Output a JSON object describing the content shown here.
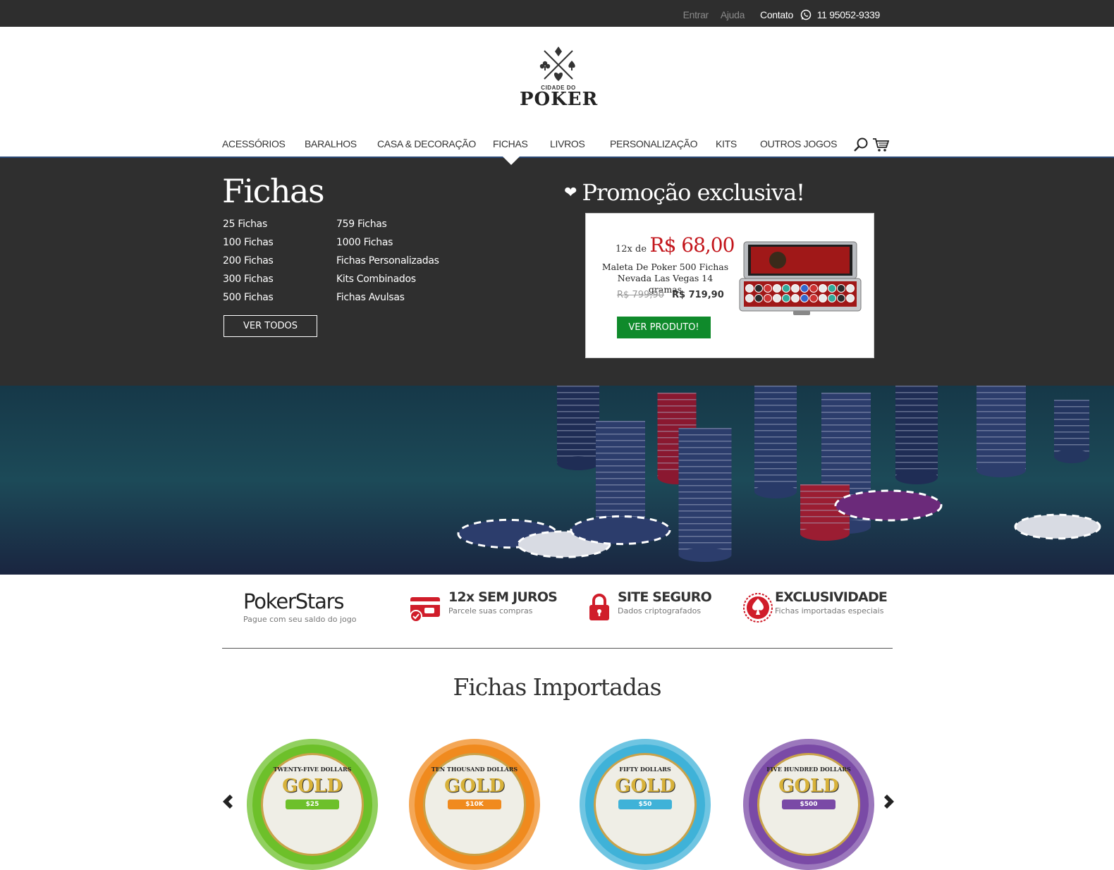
{
  "topbar": {
    "login": "Entrar",
    "help": "Ajuda",
    "contact": "Contato",
    "phone": "11 95052-9339"
  },
  "logo": {
    "line1": "CIDADE DO",
    "line2": "POKER"
  },
  "nav": {
    "items": [
      "ACESSÓRIOS",
      "BARALHOS",
      "CASA & DECORAÇÃO",
      "FICHAS",
      "LIVROS",
      "PERSONALIZAÇÃO",
      "KITS",
      "OUTROS JOGOS"
    ],
    "active": "FICHAS"
  },
  "megamenu": {
    "title": "Fichas",
    "col1": [
      "25 Fichas",
      "100 Fichas",
      "200 Fichas",
      "300 Fichas",
      "500 Fichas"
    ],
    "col2": [
      "759 Fichas",
      "1000 Fichas",
      "Fichas Personalizadas",
      "Kits Combinados",
      "Fichas Avulsas"
    ],
    "see_all": "VER TODOS"
  },
  "promo": {
    "title": "Promoção exclusiva!",
    "installments_prefix": "12x de",
    "installment_price": "R$ 68,00",
    "product_name": "Maleta De Poker 500 Fichas Nevada Las Vegas 14 gramas",
    "old_price": "R$ 799,90",
    "price": "R$ 719,90",
    "button": "VER PRODUTO!"
  },
  "features": [
    {
      "title": "PokerStars",
      "subtitle": "Pague com seu saldo do jogo"
    },
    {
      "title": "12x SEM JUROS",
      "subtitle": "Parcele suas compras"
    },
    {
      "title": "SITE SEGURO",
      "subtitle": "Dados criptografados"
    },
    {
      "title": "EXCLUSIVIDADE",
      "subtitle": "Fichas importadas especiais"
    }
  ],
  "section": {
    "title": "Fichas Importadas"
  },
  "colors": {
    "topbar": "#2e2e2e",
    "megamenu": "#2f2f2f",
    "accent_red": "#c3161c",
    "button_green": "#0f8a2b",
    "nav_line": "#2b4a77"
  },
  "chips": [
    {
      "color": "#6dc02a",
      "label": "TWENTY-FIVE DOLLARS",
      "value": "$25"
    },
    {
      "color": "#f08a1e",
      "label": "TEN THOUSAND DOLLARS",
      "value": "$10K"
    },
    {
      "color": "#3fb2d8",
      "label": "FIFTY DOLLARS",
      "value": "$50"
    },
    {
      "color": "#7a4aa6",
      "label": "FIVE HUNDRED DOLLARS",
      "value": "$500"
    }
  ]
}
